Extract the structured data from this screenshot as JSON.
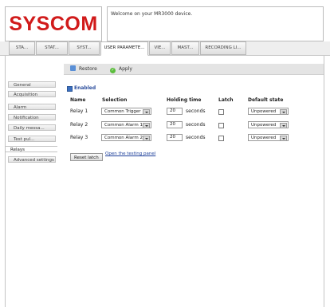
{
  "header": {
    "logo_text": "SYSCOM",
    "welcome": "Welcome on your MR3000 device."
  },
  "tabs": [
    {
      "label": "STA..."
    },
    {
      "label": "STAT..."
    },
    {
      "label": "SYST..."
    },
    {
      "label": "USER PARAMETE...",
      "active": true
    },
    {
      "label": "VIE..."
    },
    {
      "label": "MAST..."
    },
    {
      "label": "RECORDING LI..."
    }
  ],
  "sidebar": {
    "items": [
      {
        "label": "General"
      },
      {
        "label": "Acquisition"
      },
      {
        "label": "Alarm"
      },
      {
        "label": "Notification"
      },
      {
        "label": "Daily messa..."
      },
      {
        "label": "Test pul..."
      },
      {
        "label": "Relays",
        "active": true
      },
      {
        "label": "Advanced settings"
      }
    ]
  },
  "toolbar": {
    "restore_label": "Restore",
    "apply_label": "Apply"
  },
  "form": {
    "enabled_label": "Enabled",
    "enabled_checked": true,
    "columns": {
      "name": "Name",
      "selection": "Selection",
      "holding_time": "Holding time",
      "latch": "Latch",
      "default_state": "Default state"
    },
    "relays": [
      {
        "name": "Relay 1",
        "selection": "Common Trigger",
        "holding_time": "20",
        "unit": "seconds",
        "latch": false,
        "default_state": "Unpowered"
      },
      {
        "name": "Relay 2",
        "selection": "Common Alarm 1",
        "holding_time": "20",
        "unit": "seconds",
        "latch": false,
        "default_state": "Unpowered"
      },
      {
        "name": "Relay 3",
        "selection": "Common Alarm 2",
        "holding_time": "20",
        "unit": "seconds",
        "latch": false,
        "default_state": "Unpowered"
      }
    ],
    "reset_latch_label": "Reset latch",
    "testing_panel_link": "Open the testing panel"
  }
}
